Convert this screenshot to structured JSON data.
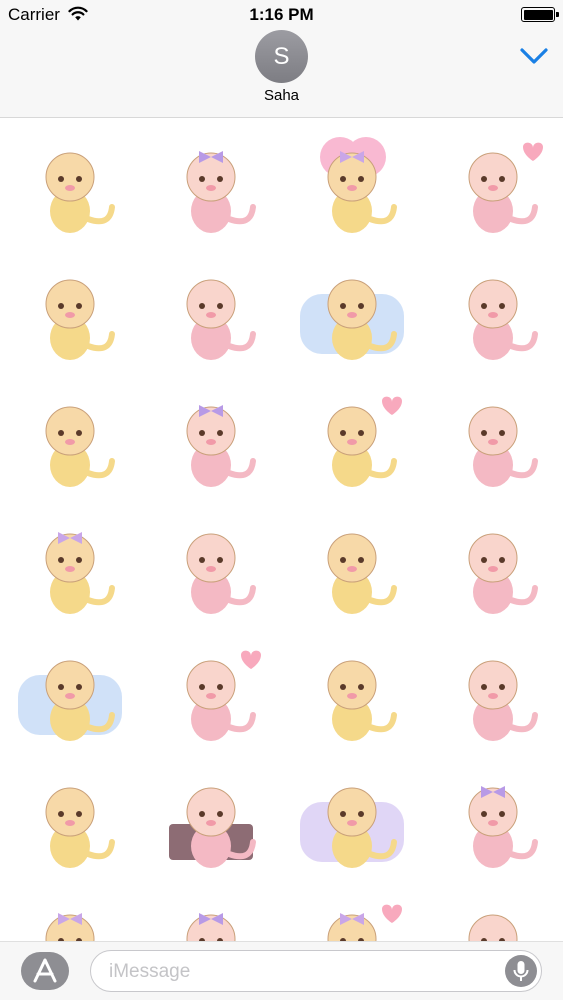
{
  "status_bar": {
    "carrier": "Carrier",
    "time": "1:16 PM",
    "battery_level": 1.0
  },
  "header": {
    "avatar_initial": "S",
    "contact_name": "Saha"
  },
  "compose": {
    "placeholder": "iMessage"
  },
  "colors": {
    "accent": "#1a80e5",
    "bar_bg": "#f7f7f7",
    "icon_gray": "#8e8e93"
  },
  "stickers": [
    [
      "monkeys-surprised-sticker",
      "monkey-girl-red-bow-sticker",
      "pink-clover-monkey-sticker",
      "monkey-with-heart-sticker"
    ],
    [
      "monkey-blue-cat-costume-sticker",
      "monkey-with-cats-sticker",
      "monkeys-sleeping-cloud-sticker",
      "monkey-with-cat-sticker"
    ],
    [
      "monkeys-winter-hats-sticker",
      "monkey-girl-in-cat-suit-sticker",
      "monkey-heart-with-cat-sticker",
      "monkey-sad-arrows-sticker"
    ],
    [
      "pink-cat-sparkle-sticker",
      "monkeys-under-blanket-sticker",
      "monkey-sweating-sticker",
      "monkey-wolf-costume-sticker"
    ],
    [
      "monkey-sleeping-moon-sticker",
      "monkeys-hearts-sticker",
      "monkeys-shopping-sticker",
      "monkeys-kissing-sticker"
    ],
    [
      "monkey-flower-shop-sticker",
      "monkey-ok-sign-sticker",
      "monkey-starry-night-sticker",
      "monkey-girl-giggling-sticker"
    ],
    [
      "monkeys-rainbow-sticker",
      "monkey-with-bows-sticker",
      "monkey-pink-heart-sticker",
      "monkeys-chefs-sticker"
    ]
  ]
}
